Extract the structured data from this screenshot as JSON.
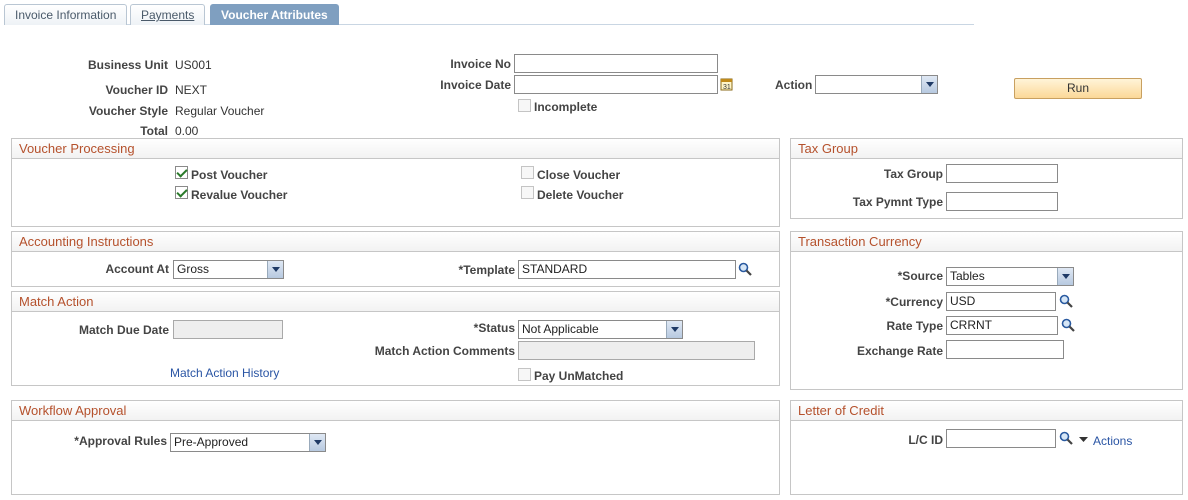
{
  "tabs": [
    "Invoice Information",
    "Payments",
    "Voucher Attributes"
  ],
  "header": {
    "business_unit_label": "Business Unit",
    "business_unit": "US001",
    "voucher_id_label": "Voucher ID",
    "voucher_id": "NEXT",
    "voucher_style_label": "Voucher Style",
    "voucher_style": "Regular Voucher",
    "total_label": "Total",
    "total": "0.00",
    "invoice_no_label": "Invoice No",
    "invoice_no": "",
    "invoice_date_label": "Invoice Date",
    "invoice_date": "",
    "incomplete_label": "Incomplete",
    "action_label": "Action",
    "action_value": "",
    "run_label": "Run"
  },
  "voucher_processing": {
    "title": "Voucher Processing",
    "post_voucher": "Post Voucher",
    "revalue_voucher": "Revalue Voucher",
    "close_voucher": "Close Voucher",
    "delete_voucher": "Delete Voucher",
    "post_checked": true,
    "revalue_checked": true
  },
  "tax_group": {
    "title": "Tax Group",
    "tax_group_label": "Tax Group",
    "tax_group_value": "",
    "tax_pymnt_type_label": "Tax Pymnt Type",
    "tax_pymnt_type_value": ""
  },
  "accounting": {
    "title": "Accounting Instructions",
    "account_at_label": "Account At",
    "account_at_value": "Gross",
    "template_label": "*Template",
    "template_value": "STANDARD"
  },
  "transaction_currency": {
    "title": "Transaction Currency",
    "source_label": "*Source",
    "source_value": "Tables",
    "currency_label": "*Currency",
    "currency_value": "USD",
    "rate_type_label": "Rate Type",
    "rate_type_value": "CRRNT",
    "exchange_rate_label": "Exchange Rate",
    "exchange_rate_value": ""
  },
  "match_action": {
    "title": "Match Action",
    "match_due_date_label": "Match Due Date",
    "match_due_date": "",
    "status_label": "*Status",
    "status_value": "Not Applicable",
    "comments_label": "Match Action Comments",
    "comments_value": "",
    "history_link": "Match Action History",
    "pay_unmatched_label": "Pay UnMatched"
  },
  "workflow": {
    "title": "Workflow Approval",
    "approval_rules_label": "*Approval Rules",
    "approval_rules_value": "Pre-Approved"
  },
  "letter_of_credit": {
    "title": "Letter of Credit",
    "lc_id_label": "L/C ID",
    "lc_id_value": "",
    "actions_label": "Actions"
  }
}
